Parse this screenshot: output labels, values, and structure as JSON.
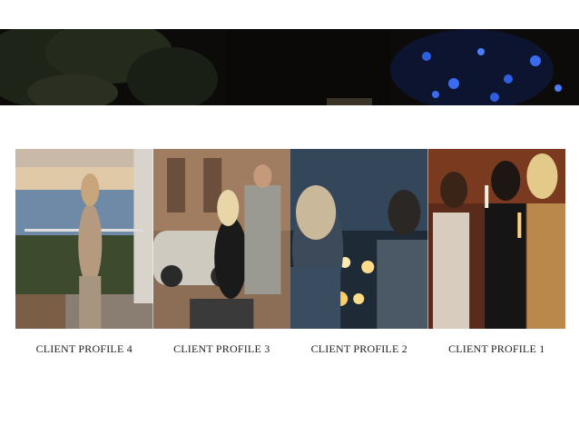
{
  "banner": {
    "description_icon": "night-scene-image"
  },
  "profiles": [
    {
      "label": "CLIENT PROFILE 4",
      "image_icon": "woman-on-balcony-image"
    },
    {
      "label": "CLIENT PROFILE 3",
      "image_icon": "couple-with-vintage-car-image"
    },
    {
      "label": "CLIENT PROFILE 2",
      "image_icon": "couple-at-night-image"
    },
    {
      "label": "CLIENT PROFILE 1",
      "image_icon": "women-with-champagne-image"
    }
  ],
  "colors": {
    "banner_bg": "#0c0b0a",
    "accent_blue": "#2f5fe0",
    "caption_text": "#222222"
  }
}
